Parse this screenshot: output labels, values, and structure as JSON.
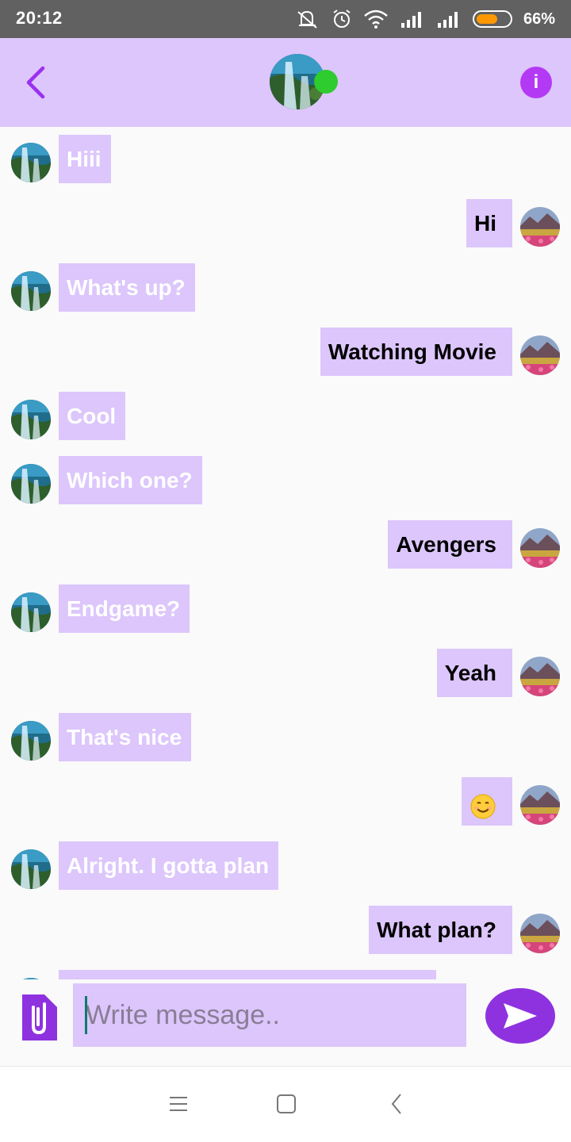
{
  "status_bar": {
    "time": "20:12",
    "battery_percent": "66%",
    "battery_level": 0.66,
    "icons": [
      "mute-icon",
      "alarm-icon",
      "wifi-icon",
      "signal-icon",
      "signal-icon",
      "battery-icon"
    ]
  },
  "header": {
    "back_icon": "chevron-left-icon",
    "contact_avatar": "waterfall-avatar",
    "online_status": "online",
    "info_icon": "info-icon",
    "info_glyph": "i",
    "accent_color": "#dcc6fb",
    "online_color": "#2ecc2e"
  },
  "messages": [
    {
      "side": "recv",
      "text": "Hiii"
    },
    {
      "side": "sent",
      "text": "Hi"
    },
    {
      "side": "recv",
      "text": "What's up?"
    },
    {
      "side": "sent",
      "text": "Watching Movie"
    },
    {
      "side": "recv",
      "text": "Cool"
    },
    {
      "side": "recv",
      "text": "Which one?"
    },
    {
      "side": "sent",
      "text": "Avengers"
    },
    {
      "side": "recv",
      "text": "Endgame?"
    },
    {
      "side": "sent",
      "text": "Yeah"
    },
    {
      "side": "recv",
      "text": "That's nice"
    },
    {
      "side": "sent",
      "text": "",
      "emoji": "smiling-face-emoji"
    },
    {
      "side": "recv",
      "text": "Alright. I gotta plan"
    },
    {
      "side": "sent",
      "text": "What plan?"
    },
    {
      "side": "recv",
      "text": ""
    }
  ],
  "composer": {
    "placeholder": "Write message..",
    "value": "",
    "attach_icon": "paperclip-icon",
    "send_icon": "send-icon",
    "send_color": "#8e32e0"
  },
  "nav_bar": {
    "icons": [
      "menu-icon",
      "home-square-icon",
      "back-icon"
    ]
  }
}
